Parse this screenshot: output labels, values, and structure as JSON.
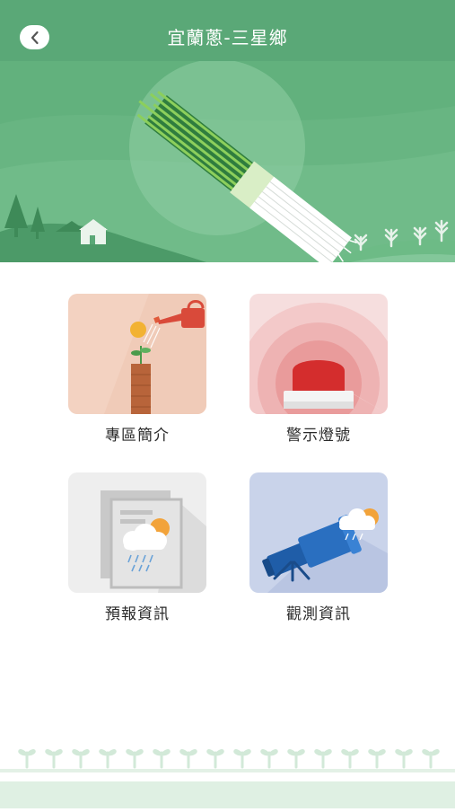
{
  "header": {
    "title": "宜蘭蔥-三星鄉",
    "back_icon": "chevron-left-icon"
  },
  "menu": {
    "items": [
      {
        "label": "專區簡介",
        "icon": "watering-plant-icon"
      },
      {
        "label": "警示燈號",
        "icon": "siren-light-icon"
      },
      {
        "label": "預報資訊",
        "icon": "weather-forecast-icon"
      },
      {
        "label": "觀測資訊",
        "icon": "telescope-icon"
      }
    ]
  },
  "colors": {
    "header": "#5aa877",
    "banner": "#62b17d",
    "tile_intro": "#f3d2c1",
    "tile_warning": "#f6dede",
    "tile_forecast": "#eeeeee",
    "tile_observe": "#c9d3ea"
  }
}
